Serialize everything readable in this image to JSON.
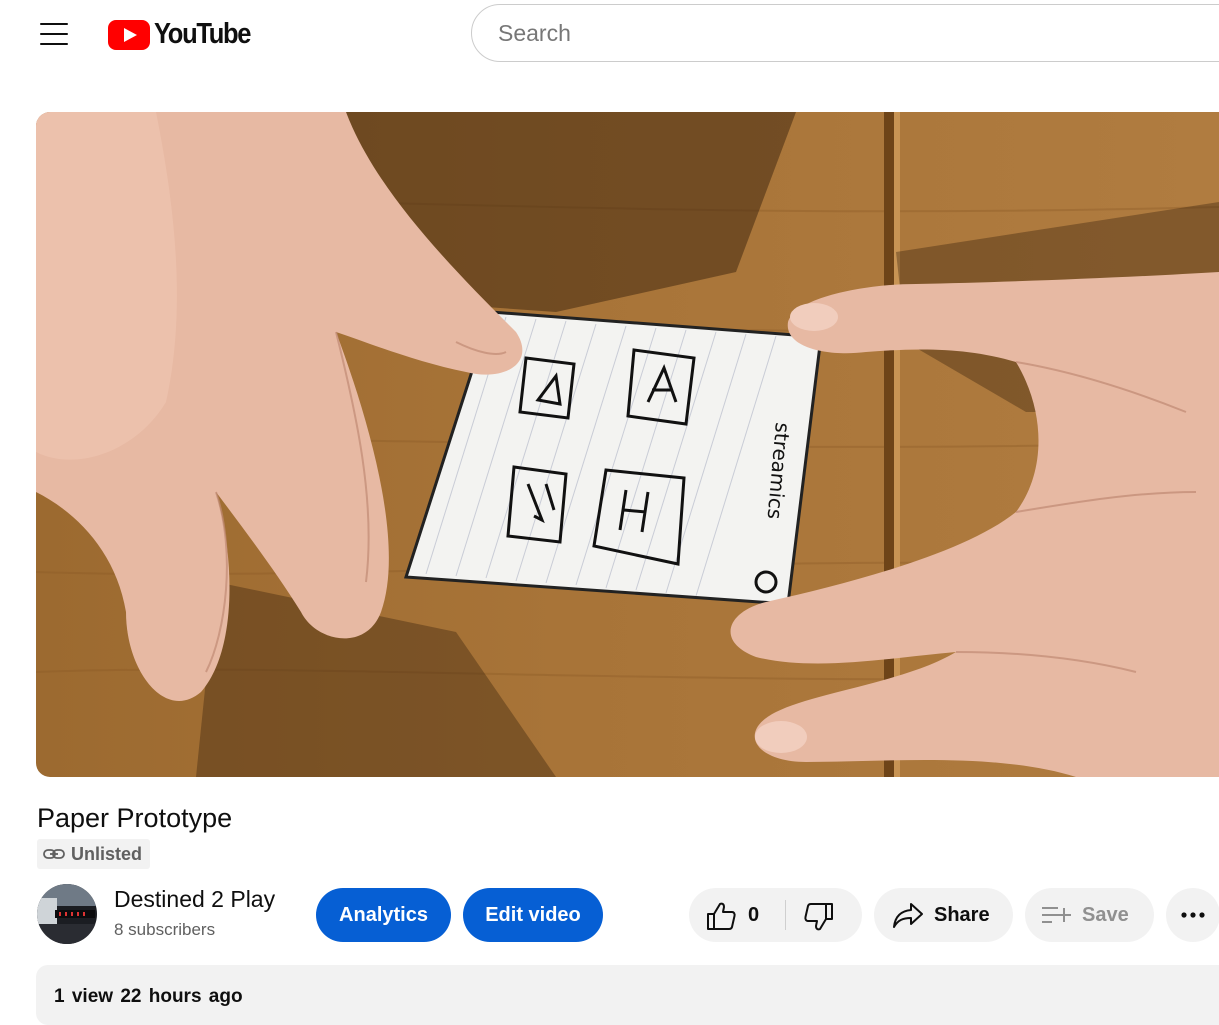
{
  "masthead": {
    "menu_icon": "hamburger-menu-icon",
    "logo_text": "YouTube",
    "search_placeholder": "Search"
  },
  "video": {
    "title": "Paper Prototype",
    "visibility": "Unlisted",
    "visibility_icon": "link-icon"
  },
  "channel": {
    "name": "Destined 2 Play",
    "subscribers": "8 subscribers"
  },
  "actions": {
    "analytics_label": "Analytics",
    "edit_label": "Edit video",
    "like_count": "0",
    "share_label": "Share",
    "save_label": "Save",
    "more_icon": "more-horizontal-icon"
  },
  "description": {
    "meta": "1 view  22 hours ago"
  },
  "colors": {
    "brand_red": "#ff0000",
    "primary_blue": "#065fd4",
    "chip_gray": "#f2f2f2"
  }
}
